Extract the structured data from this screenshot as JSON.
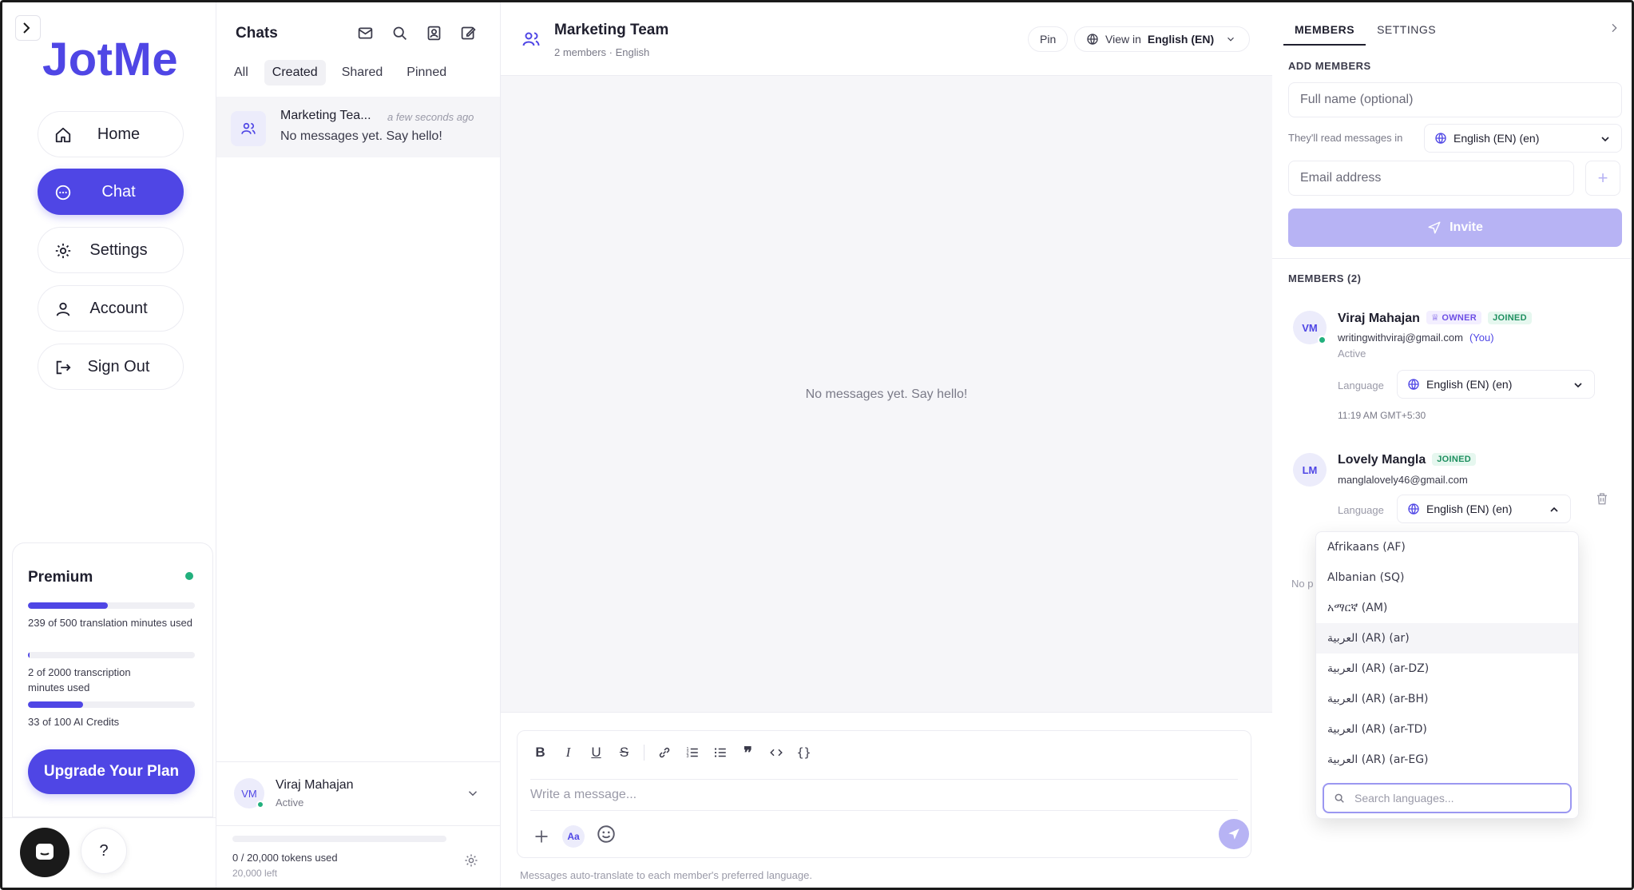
{
  "app": {
    "name": "JotMe"
  },
  "nav": {
    "items": [
      {
        "label": "Home",
        "icon": "home-icon"
      },
      {
        "label": "Chat",
        "icon": "chat-icon",
        "active": true
      },
      {
        "label": "Settings",
        "icon": "gear-icon"
      },
      {
        "label": "Account",
        "icon": "user-icon"
      },
      {
        "label": "Sign Out",
        "icon": "sign-out-icon"
      }
    ]
  },
  "premium": {
    "title": "Premium",
    "usage": [
      {
        "text": "239 of 500 translation minutes used",
        "fraction": 0.478
      },
      {
        "text": "2 of 2000 transcription minutes used",
        "fraction": 0.001
      },
      {
        "text": "33 of 100 AI Credits",
        "fraction": 0.33
      }
    ],
    "upgrade_label": "Upgrade Your Plan"
  },
  "help": {
    "label": "?"
  },
  "chats": {
    "title": "Chats",
    "filters": [
      "All",
      "Created",
      "Shared",
      "Pinned"
    ],
    "active_filter": "Created",
    "items": [
      {
        "name": "Marketing Tea...",
        "time": "a few seconds ago",
        "preview": "No messages yet. Say hello!"
      }
    ],
    "me": {
      "initials": "VM",
      "name": "Viraj Mahajan",
      "status": "Active"
    },
    "tokens": {
      "used": "0 / 20,000 tokens used",
      "left": "20,000 left",
      "fraction": 0
    }
  },
  "conversation": {
    "title": "Marketing Team",
    "subtitle": "2 members · English",
    "pin_label": "Pin",
    "view_in_label": "View in",
    "view_in_value": "English (EN)",
    "empty": "No messages yet. Say hello!",
    "composer": {
      "placeholder": "Write a message...",
      "aa_label": "Aa",
      "hint": "Messages auto-translate to each member's preferred language."
    }
  },
  "right_panel": {
    "tabs": [
      "MEMBERS",
      "SETTINGS"
    ],
    "active_tab": "MEMBERS",
    "add_members": {
      "label": "ADD MEMBERS",
      "name_placeholder": "Full name (optional)",
      "read_label": "They'll read messages in",
      "read_value": "English (EN) (en)",
      "email_placeholder": "Email address",
      "plus_label": "+",
      "invite_label": "Invite"
    },
    "members_label": "MEMBERS (2)",
    "members": [
      {
        "initials": "VM",
        "name": "Viraj Mahajan",
        "owner_badge": "OWNER",
        "joined_badge": "JOINED",
        "email": "writingwithviraj@gmail.com",
        "you": "(You)",
        "status": "Active",
        "language_label": "Language",
        "language": "English (EN) (en)",
        "time": "11:19 AM GMT+5:30"
      },
      {
        "initials": "LM",
        "name": "Lovely Mangla",
        "joined_badge": "JOINED",
        "email": "manglalovely46@gmail.com",
        "language_label": "Language",
        "language": "English (EN) (en)"
      }
    ],
    "no_prefix": "No p",
    "language_dropdown": {
      "options": [
        "Afrikaans (AF)",
        "Albanian (SQ)",
        "አማርኛ (AM)",
        "العربية (AR) (ar)",
        "العربية (AR) (ar-DZ)",
        "العربية (AR) (ar-BH)",
        "العربية (AR) (ar-TD)",
        "العربية (AR) (ar-EG)"
      ],
      "hovered_index": 3,
      "search_placeholder": "Search languages..."
    }
  },
  "colors": {
    "accent": "#4f46e5",
    "accent_light": "#b7b3f4",
    "online": "#22b07d"
  }
}
